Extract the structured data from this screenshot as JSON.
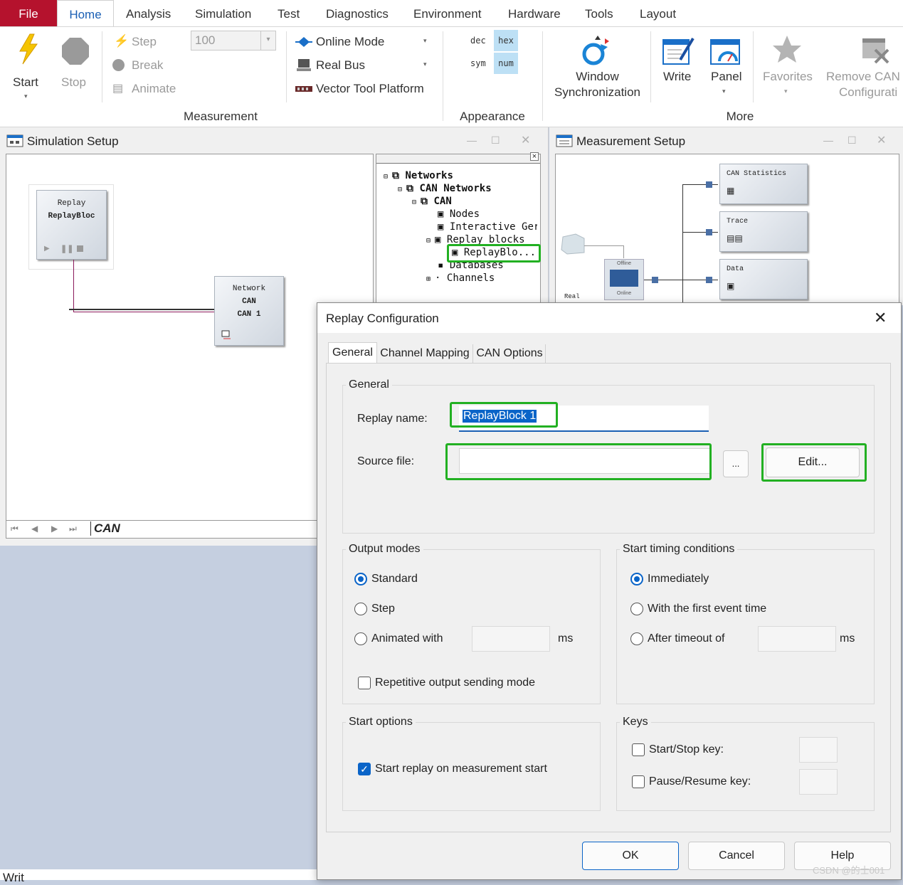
{
  "menu": {
    "file": "File",
    "tabs": [
      "Home",
      "Analysis",
      "Simulation",
      "Test",
      "Diagnostics",
      "Environment",
      "Hardware",
      "Tools",
      "Layout"
    ]
  },
  "ribbon": {
    "start": "Start",
    "stop": "Stop",
    "step": "Step",
    "break": "Break",
    "animate": "Animate",
    "speed_value": "100",
    "online_mode": "Online Mode",
    "real_bus": "Real Bus",
    "vector_tool_platform": "Vector Tool Platform",
    "measurement_group": "Measurement",
    "dec": "dec",
    "hex": "hex",
    "sym": "sym",
    "num": "num",
    "appearance_group": "Appearance",
    "window_sync_1": "Window",
    "window_sync_2": "Synchronization",
    "write": "Write",
    "panel": "Panel",
    "favorites": "Favorites",
    "remove_can_1": "Remove CAN",
    "remove_can_2": "Configurati",
    "more_group": "More"
  },
  "simulation_setup": {
    "title": "Simulation Setup",
    "replay_block_line1": "Replay",
    "replay_block_line2": "ReplayBloc",
    "network_line1": "Network",
    "network_line2": "CAN",
    "network_line3": "CAN 1",
    "bottom_tab": "CAN",
    "tree": {
      "networks": "Networks",
      "can_networks": "CAN Networks",
      "can": "CAN",
      "nodes": "Nodes",
      "interactive": "Interactive Ger",
      "replay_blocks": "Replay blocks",
      "replay_block_item": "ReplayBlo...",
      "databases": "Databases",
      "channels": "Channels"
    }
  },
  "measurement_setup": {
    "title": "Measurement Setup",
    "can_statistics": "CAN Statistics",
    "trace": "Trace",
    "data": "Data",
    "offline": "Offline",
    "online": "Online",
    "real": "Real"
  },
  "dialog": {
    "title": "Replay Configuration",
    "tabs": [
      "General",
      "Channel Mapping",
      "CAN Options"
    ],
    "general_group": "General",
    "replay_name_label": "Replay name:",
    "replay_name_value": "ReplayBlock 1",
    "source_file_label": "Source file:",
    "source_file_value": "",
    "browse": "...",
    "edit": "Edit...",
    "output_modes": "Output modes",
    "standard": "Standard",
    "step": "Step",
    "animated_with": "Animated with",
    "ms1": "ms",
    "repetitive": "Repetitive output sending mode",
    "start_timing": "Start timing conditions",
    "immediately": "Immediately",
    "first_event": "With the first event time",
    "after_timeout": "After timeout of",
    "ms2": "ms",
    "start_options": "Start options",
    "start_replay": "Start replay on measurement start",
    "keys": "Keys",
    "start_stop_key": "Start/Stop key:",
    "pause_resume_key": "Pause/Resume key:",
    "ok": "OK",
    "cancel": "Cancel",
    "help": "Help"
  },
  "watermark": "CSDN @的士001",
  "footer_text": "Writ"
}
